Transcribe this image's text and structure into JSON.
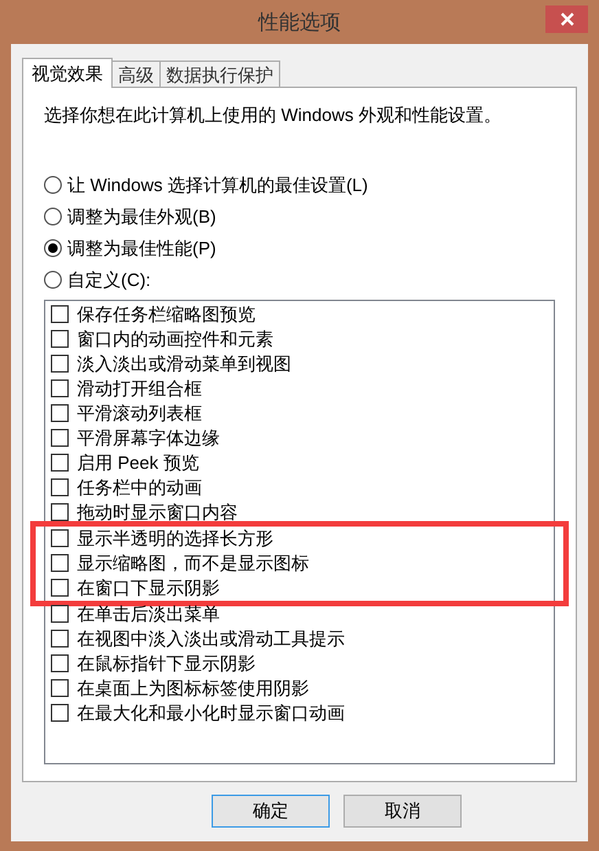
{
  "window": {
    "title": "性能选项"
  },
  "tabs": [
    {
      "label": "视觉效果",
      "selected": true
    },
    {
      "label": "高级",
      "selected": false
    },
    {
      "label": "数据执行保护",
      "selected": false
    }
  ],
  "description": "选择你想在此计算机上使用的 Windows 外观和性能设置。",
  "radios": [
    {
      "label": "让 Windows 选择计算机的最佳设置(L)",
      "selected": false
    },
    {
      "label": "调整为最佳外观(B)",
      "selected": false
    },
    {
      "label": "调整为最佳性能(P)",
      "selected": true
    },
    {
      "label": "自定义(C):",
      "selected": false
    }
  ],
  "options": [
    {
      "label": "保存任务栏缩略图预览",
      "checked": false,
      "highlighted": false
    },
    {
      "label": "窗口内的动画控件和元素",
      "checked": false,
      "highlighted": false
    },
    {
      "label": "淡入淡出或滑动菜单到视图",
      "checked": false,
      "highlighted": false
    },
    {
      "label": "滑动打开组合框",
      "checked": false,
      "highlighted": false
    },
    {
      "label": "平滑滚动列表框",
      "checked": false,
      "highlighted": false
    },
    {
      "label": "平滑屏幕字体边缘",
      "checked": false,
      "highlighted": false
    },
    {
      "label": "启用 Peek 预览",
      "checked": false,
      "highlighted": false
    },
    {
      "label": "任务栏中的动画",
      "checked": false,
      "highlighted": false
    },
    {
      "label": "拖动时显示窗口内容",
      "checked": false,
      "highlighted": false
    },
    {
      "label": "显示半透明的选择长方形",
      "checked": false,
      "highlighted": true
    },
    {
      "label": "显示缩略图，而不是显示图标",
      "checked": false,
      "highlighted": true
    },
    {
      "label": "在窗口下显示阴影",
      "checked": false,
      "highlighted": true
    },
    {
      "label": "在单击后淡出菜单",
      "checked": false,
      "highlighted": false
    },
    {
      "label": "在视图中淡入淡出或滑动工具提示",
      "checked": false,
      "highlighted": false
    },
    {
      "label": "在鼠标指针下显示阴影",
      "checked": false,
      "highlighted": false
    },
    {
      "label": "在桌面上为图标标签使用阴影",
      "checked": false,
      "highlighted": false
    },
    {
      "label": "在最大化和最小化时显示窗口动画",
      "checked": false,
      "highlighted": false
    }
  ],
  "buttons": [
    {
      "label": "确定",
      "default": true
    },
    {
      "label": "取消",
      "default": false
    }
  ]
}
